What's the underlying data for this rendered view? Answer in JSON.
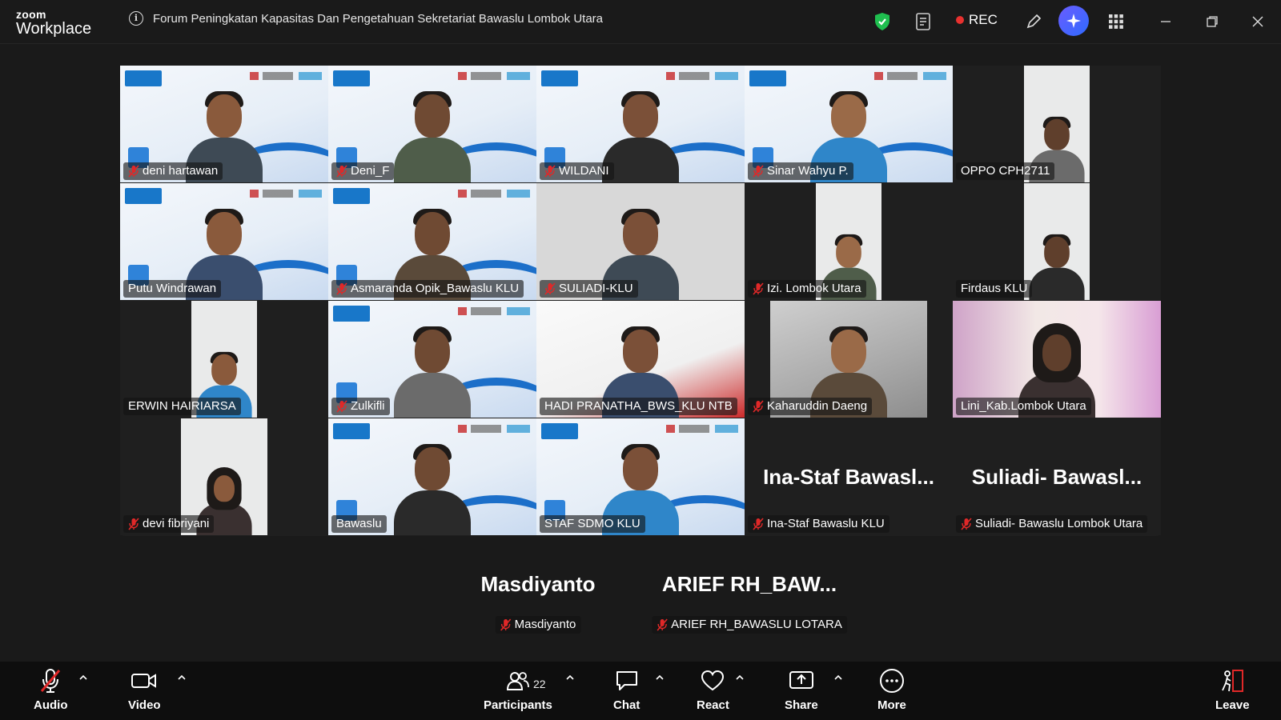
{
  "app": {
    "brand_small": "zoom",
    "brand_large": "Workplace"
  },
  "meeting": {
    "title": "Forum Peningkatan Kapasitas Dan Pengetahuan Sekretariat Bawaslu Lombok Utara"
  },
  "titlebar": {
    "rec_label": "REC",
    "colors": {
      "shield": "#1fbf4f",
      "rec_dot": "#e8312f",
      "ai_button": "#4d5dff"
    }
  },
  "participants_grid": [
    {
      "name": "deni hartawan",
      "muted": true,
      "bg": "banner"
    },
    {
      "name": "Deni_F",
      "muted": true,
      "bg": "banner"
    },
    {
      "name": "WILDANI",
      "muted": true,
      "bg": "banner"
    },
    {
      "name": "Sinar Wahyu P.",
      "muted": true,
      "bg": "banner"
    },
    {
      "name": "OPPO CPH2711",
      "muted": false,
      "bg": "wall"
    },
    {
      "name": "Putu Windrawan",
      "muted": false,
      "bg": "banner"
    },
    {
      "name": "Asmaranda Opik_Bawaslu KLU",
      "muted": true,
      "bg": "banner"
    },
    {
      "name": "SULIADI-KLU",
      "muted": true,
      "bg": "grey"
    },
    {
      "name": "Izi. Lombok Utara",
      "muted": true,
      "bg": "wall"
    },
    {
      "name": "Firdaus KLU",
      "muted": false,
      "bg": "wall"
    },
    {
      "name": "ERWIN HAIRIARSA",
      "muted": false,
      "bg": "wall"
    },
    {
      "name": "Zulkifli",
      "muted": true,
      "bg": "banner"
    },
    {
      "name": "HADI PRANATHA_BWS_KLU NTB",
      "muted": false,
      "bg": "red"
    },
    {
      "name": "Kaharuddin Daeng",
      "muted": true,
      "bg": "car"
    },
    {
      "name": "Lini_Kab.Lombok Utara",
      "muted": false,
      "bg": "pink"
    },
    {
      "name": "devi fibriyani",
      "muted": true,
      "bg": "wall"
    },
    {
      "name": "Bawaslu",
      "muted": false,
      "bg": "banner",
      "active_speaker": true
    },
    {
      "name": "STAF SDMO KLU",
      "muted": false,
      "bg": "banner"
    },
    {
      "name": "Ina-Staf Bawaslu KLU",
      "muted": true,
      "video_off": true,
      "display_name": "Ina-Staf  Bawasl..."
    },
    {
      "name": "Suliadi- Bawaslu Lombok Utara",
      "muted": true,
      "video_off": true,
      "display_name": "Suliadi-  Bawasl..."
    }
  ],
  "overflow_row": [
    {
      "name": "Masdiyanto",
      "display_name": "Masdiyanto",
      "muted": true
    },
    {
      "name": "ARIEF RH_BAWASLU LOTARA",
      "display_name": "ARIEF  RH_BAW...",
      "muted": true
    }
  ],
  "toolbar": {
    "audio_label": "Audio",
    "video_label": "Video",
    "participants_label": "Participants",
    "participants_count": "22",
    "chat_label": "Chat",
    "react_label": "React",
    "share_label": "Share",
    "more_label": "More",
    "leave_label": "Leave",
    "colors": {
      "mic_muted": "#e02828",
      "leave": "#e02828"
    }
  }
}
